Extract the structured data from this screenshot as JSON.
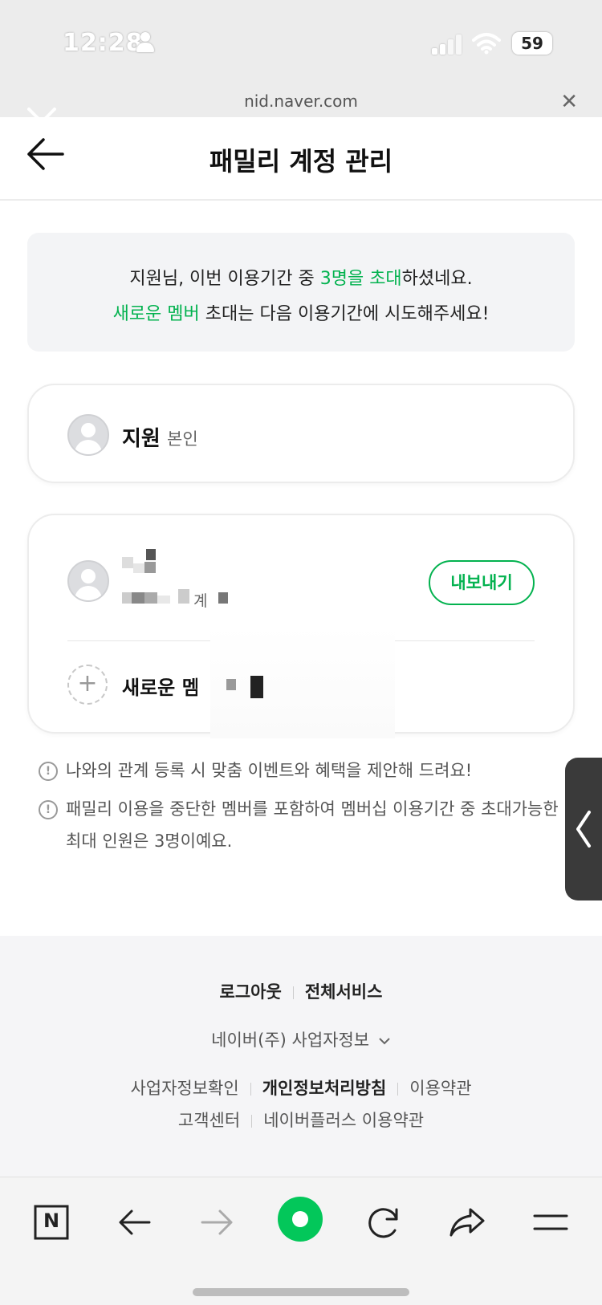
{
  "status_bar": {
    "time": "12:28",
    "battery": "59"
  },
  "browser": {
    "url": "nid.naver.com"
  },
  "header": {
    "title": "패밀리 계정 관리"
  },
  "notice": {
    "line1_part1": "지원님, 이번 이용기간 중 ",
    "line1_highlight": "3명을 초대",
    "line1_part2": "하셨네요.",
    "line2_highlight": "새로운 멤버",
    "line2_part2": " 초대는 다음 이용기간에 시도해주세요!"
  },
  "self_card": {
    "name": "지원",
    "tag": "본인"
  },
  "member_card": {
    "member_suffix": "계",
    "export_label": "내보내기",
    "add_label": "새로운 멤버"
  },
  "info": {
    "line1": "나와의 관계 등록 시 맞춤 이벤트와 혜택을 제안해 드려요!",
    "line2": "패밀리 이용을 중단한 멤버를 포함하여 멤버십 이용기간 중 초대가능한 최대 인원은 3명이예요."
  },
  "footer": {
    "logout": "로그아웃",
    "all_services": "전체서비스",
    "company_info": "네이버(주) 사업자정보",
    "business_check": "사업자정보확인",
    "privacy_policy": "개인정보처리방침",
    "terms": "이용약관",
    "customer_center": "고객센터",
    "plus_terms": "네이버플러스 이용약관"
  },
  "toolbar": {
    "home_letter": "N"
  },
  "colors": {
    "accent": "#03b24f",
    "background": "#ffffff",
    "notice_bg": "#f3f4f6",
    "footer_bg": "#f5f5f7"
  }
}
